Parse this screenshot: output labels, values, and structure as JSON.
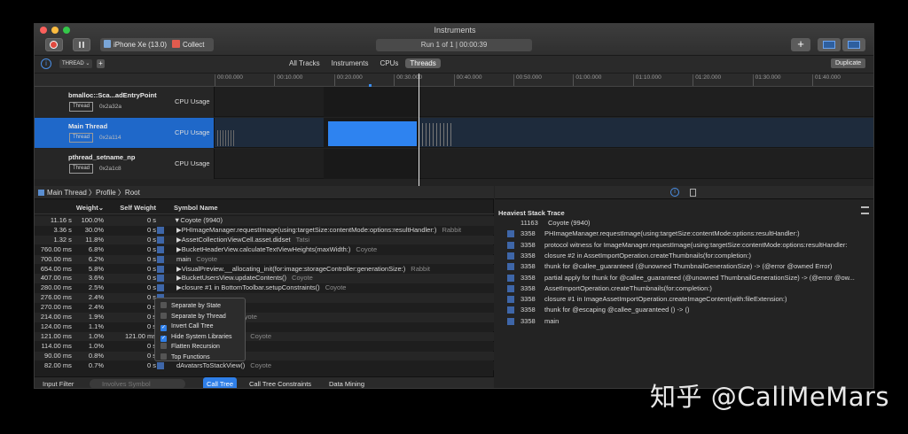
{
  "window": {
    "title": "Instruments"
  },
  "toolbar": {
    "device": "iPhone Xe (13.0)",
    "target": "Collect",
    "run_status": "Run 1 of 1  |  00:00:39",
    "add_label": "+"
  },
  "secondary": {
    "thread_filter": "THREAD ⌄",
    "add_filter": "+",
    "tabs": [
      "All Tracks",
      "Instruments",
      "CPUs",
      "Threads"
    ],
    "active_tab": "Threads",
    "duplicate_label": "Duplicate"
  },
  "ruler": [
    "00:00.000",
    "00:10.000",
    "00:20.000",
    "00:30.000",
    "00:40.000",
    "00:50.000",
    "01:00.000",
    "01:10.000",
    "01:20.000",
    "01:30.000",
    "01:40.000"
  ],
  "tracks": [
    {
      "name": "bmalloc::Sca...adEntryPoint",
      "badge": "Thread",
      "id": "0x2a32a",
      "instrument": "CPU Usage"
    },
    {
      "name": "Main Thread",
      "badge": "Thread",
      "id": "0x2a114",
      "instrument": "CPU Usage"
    },
    {
      "name": "pthread_setname_np",
      "badge": "Thread",
      "id": "0x2a1c8",
      "instrument": "CPU Usage"
    }
  ],
  "breadcrumb": [
    "Main Thread",
    "Profile",
    "Root"
  ],
  "columns": {
    "weight": "Weight⌄",
    "self": "Self Weight",
    "symbol": "Symbol Name"
  },
  "rows": [
    {
      "w": "11.16 s",
      "p": "100.0%",
      "s": "0 s",
      "sym": "▼Coyote (9940)",
      "lib": ""
    },
    {
      "w": "3.36 s",
      "p": "30.0%",
      "s": "0 s",
      "sym": "▶PHImageManager.requestImage(using:targetSize:contentMode:options:resultHandler:)",
      "lib": "Rabbit"
    },
    {
      "w": "1.32 s",
      "p": "11.8%",
      "s": "0 s",
      "sym": "▶AssetCollectionViewCell.asset.didset",
      "lib": "Tatsi"
    },
    {
      "w": "760.00 ms",
      "p": "6.8%",
      "s": "0 s",
      "sym": "▶BucketHeaderView.calculateTextViewHeights(maxWidth:)",
      "lib": "Coyote"
    },
    {
      "w": "700.00 ms",
      "p": "6.2%",
      "s": "0 s",
      "sym": "main",
      "lib": "Coyote"
    },
    {
      "w": "654.00 ms",
      "p": "5.8%",
      "s": "0 s",
      "sym": "▶VisualPreview.__allocating_init(for:image:storageController:generationSize:)",
      "lib": "Rabbit"
    },
    {
      "w": "407.00 ms",
      "p": "3.6%",
      "s": "0 s",
      "sym": "▶BucketUsersView.updateContents()",
      "lib": "Coyote"
    },
    {
      "w": "280.00 ms",
      "p": "2.5%",
      "s": "0 s",
      "sym": "▶closure #1 in BottomToolbar.setupConstraints()",
      "lib": "Coyote"
    },
    {
      "w": "276.00 ms",
      "p": "2.4%",
      "s": "0 s",
      "sym": "",
      "lib": ""
    },
    {
      "w": "270.00 ms",
      "p": "2.4%",
      "s": "0 s",
      "sym": "hange(_:)",
      "lib": "Coyote"
    },
    {
      "w": "214.00 ms",
      "p": "1.9%",
      "s": "0 s",
      "sym": "Buttons(oldValue:)",
      "lib": "Coyote"
    },
    {
      "w": "124.00 ms",
      "p": "1.1%",
      "s": "0 s",
      "sym": "entSize.getter",
      "lib": "Coyote"
    },
    {
      "w": "121.00 ms",
      "p": "1.0%",
      "s": "121.00 ms",
      "sym": "dAvatarsToStackView()",
      "lib": "Coyote"
    },
    {
      "w": "114.00 ms",
      "p": "1.0%",
      "s": "0 s",
      "sym": "",
      "lib": ""
    },
    {
      "w": "90.00 ms",
      "p": "0.8%",
      "s": "0 s",
      "sym": "ts()",
      "lib": "Coyote"
    },
    {
      "w": "82.00 ms",
      "p": "0.7%",
      "s": "0 s",
      "sym": "dAvatarsToStackView()",
      "lib": "Coyote"
    }
  ],
  "menu": [
    {
      "label": "Separate by State",
      "checked": false
    },
    {
      "label": "Separate by Thread",
      "checked": false
    },
    {
      "label": "Invert Call Tree",
      "checked": true
    },
    {
      "label": "Hide System Libraries",
      "checked": true
    },
    {
      "label": "Flatten Recursion",
      "checked": false
    },
    {
      "label": "Top Functions",
      "checked": false
    }
  ],
  "bottom": {
    "input_filter": "Input Filter",
    "search_placeholder": "Involves Symbol",
    "tabs": [
      "Call Tree",
      "Call Tree Constraints",
      "Data Mining"
    ],
    "active": "Call Tree"
  },
  "stack": {
    "title": "Heaviest Stack Trace",
    "rows": [
      {
        "c": "11163",
        "t": "Coyote (9940)",
        "icon": false
      },
      {
        "c": "3358",
        "t": "PHImageManager.requestImage(using:targetSize:contentMode:options:resultHandler:)",
        "icon": true
      },
      {
        "c": "3358",
        "t": "protocol witness for ImageManager.requestImage(using:targetSize:contentMode:options:resultHandler:",
        "icon": true
      },
      {
        "c": "3358",
        "t": "closure #2 in AssetImportOperation.createThumbnails(for:completion:)",
        "icon": true
      },
      {
        "c": "3358",
        "t": "thunk for @callee_guaranteed (@unowned ThumbnailGenerationSize) -> (@error @owned Error)",
        "icon": true
      },
      {
        "c": "3358",
        "t": "partial apply for thunk for @callee_guaranteed (@unowned ThumbnailGenerationSize) -> (@error @ow...",
        "icon": true
      },
      {
        "c": "3358",
        "t": "AssetImportOperation.createThumbnails(for:completion:)",
        "icon": true
      },
      {
        "c": "3358",
        "t": "closure #1 in ImageAssetImportOperation.createImageContent(with:fileExtension:)",
        "icon": true
      },
      {
        "c": "3358",
        "t": "thunk for @escaping @callee_guaranteed () -> ()",
        "icon": true
      },
      {
        "c": "3358",
        "t": "main",
        "icon": true
      }
    ]
  },
  "watermark": "知乎 @CallMeMars"
}
